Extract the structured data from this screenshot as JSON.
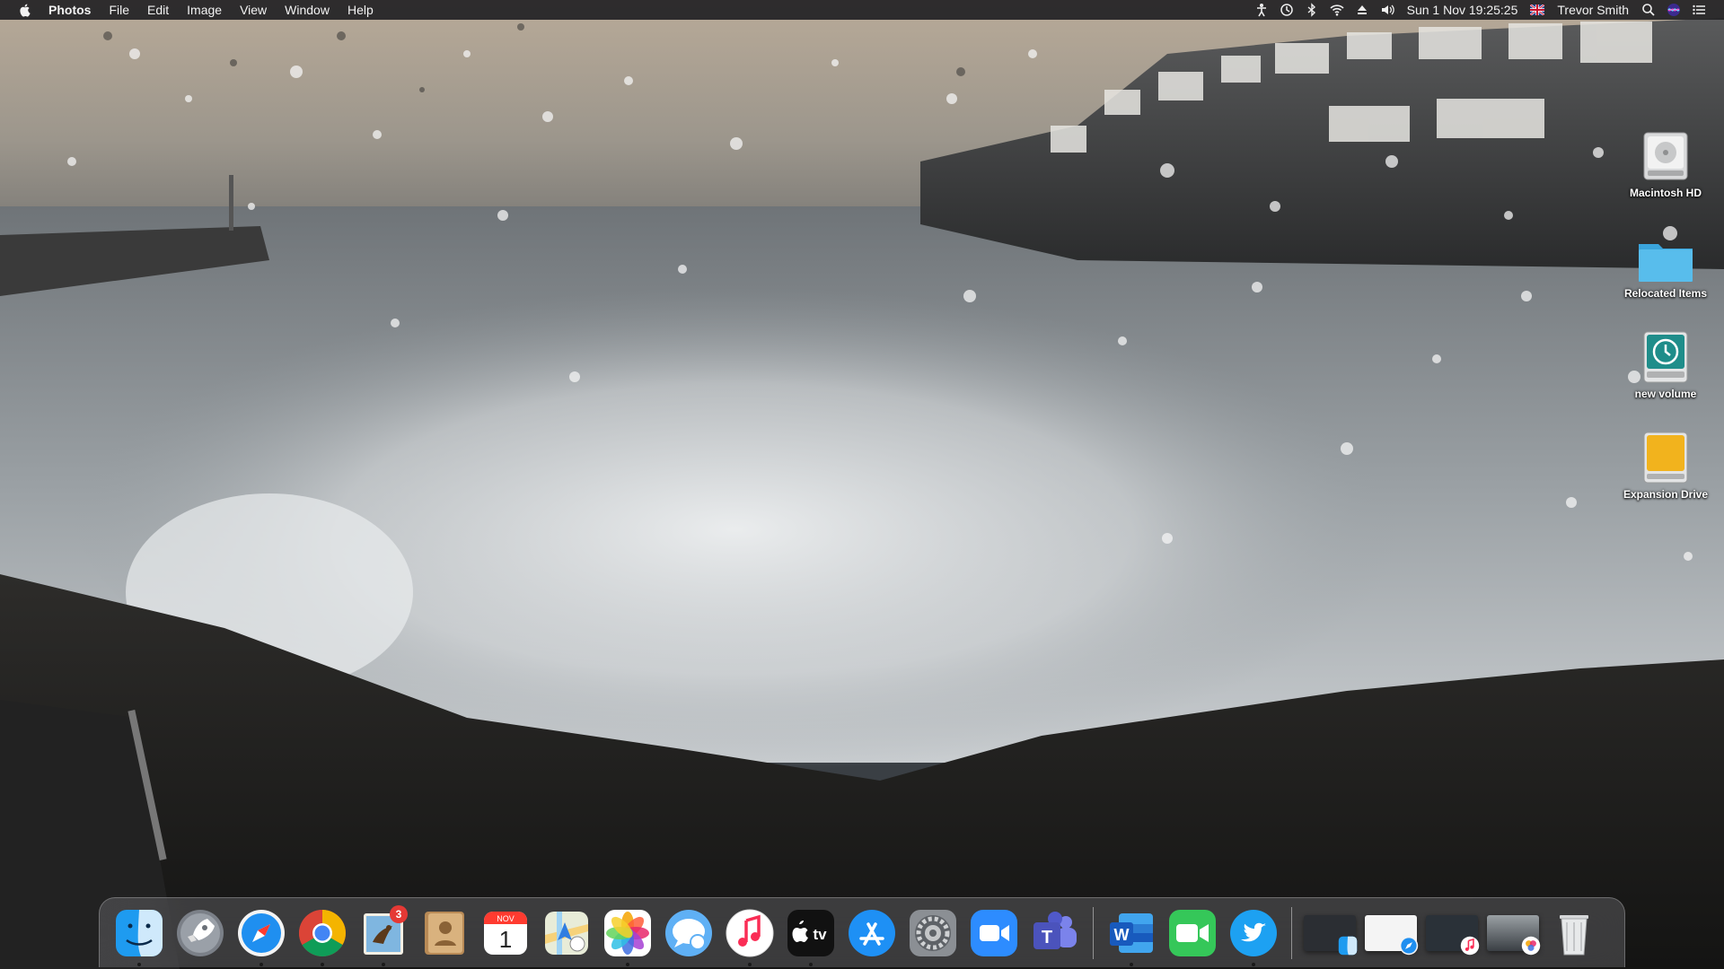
{
  "menubar": {
    "app_name": "Photos",
    "menus": [
      "File",
      "Edit",
      "Image",
      "View",
      "Window",
      "Help"
    ],
    "status_icons": [
      "accessibility-icon",
      "time-machine-icon",
      "bluetooth-icon",
      "wifi-icon",
      "eject-icon",
      "volume-icon"
    ],
    "clock": "Sun 1 Nov  19:25:25",
    "input_source": "uk-flag-icon",
    "user": "Trevor Smith"
  },
  "desktop_icons": [
    {
      "label": "Macintosh HD",
      "icon": "hard-drive-icon"
    },
    {
      "label": "Relocated Items",
      "icon": "folder-icon"
    },
    {
      "label": "new volume",
      "icon": "time-machine-drive-icon"
    },
    {
      "label": "Expansion Drive",
      "icon": "external-drive-icon"
    }
  ],
  "dock": {
    "apps": [
      {
        "name": "Finder",
        "icon": "finder-icon",
        "running": true
      },
      {
        "name": "Launchpad",
        "icon": "launchpad-icon",
        "running": false
      },
      {
        "name": "Safari",
        "icon": "safari-icon",
        "running": true
      },
      {
        "name": "Chrome",
        "icon": "chrome-icon",
        "running": true
      },
      {
        "name": "Mail",
        "icon": "mail-icon",
        "running": true,
        "badge": "3"
      },
      {
        "name": "Contacts",
        "icon": "contacts-icon",
        "running": false
      },
      {
        "name": "Calendar",
        "icon": "calendar-icon",
        "running": false,
        "month": "NOV",
        "day": "1"
      },
      {
        "name": "Maps",
        "icon": "maps-icon",
        "running": false
      },
      {
        "name": "Photos",
        "icon": "photos-icon",
        "running": true
      },
      {
        "name": "Messages",
        "icon": "messages-icon",
        "running": false
      },
      {
        "name": "Music",
        "icon": "music-icon",
        "running": true
      },
      {
        "name": "TV",
        "icon": "tv-icon",
        "running": true,
        "label": "tv"
      },
      {
        "name": "App Store",
        "icon": "app-store-icon",
        "running": false
      },
      {
        "name": "System Preferences",
        "icon": "system-preferences-icon",
        "running": false
      },
      {
        "name": "Zoom",
        "icon": "zoom-icon",
        "running": false
      },
      {
        "name": "Teams",
        "icon": "teams-icon",
        "running": false,
        "letter": "T"
      },
      {
        "name": "Word",
        "icon": "word-icon",
        "running": true,
        "letter": "W"
      },
      {
        "name": "FaceTime",
        "icon": "facetime-icon",
        "running": false
      },
      {
        "name": "Twitter",
        "icon": "twitter-icon",
        "running": true
      }
    ],
    "minimized": [
      {
        "name": "minimized-window-1",
        "badge_icon": "finder-icon"
      },
      {
        "name": "minimized-window-2",
        "badge_icon": "safari-icon"
      },
      {
        "name": "minimized-window-3",
        "badge_icon": "music-icon"
      },
      {
        "name": "minimized-window-4",
        "badge_icon": "photos-icon"
      }
    ],
    "trash": {
      "name": "Trash",
      "icon": "trash-icon"
    }
  }
}
